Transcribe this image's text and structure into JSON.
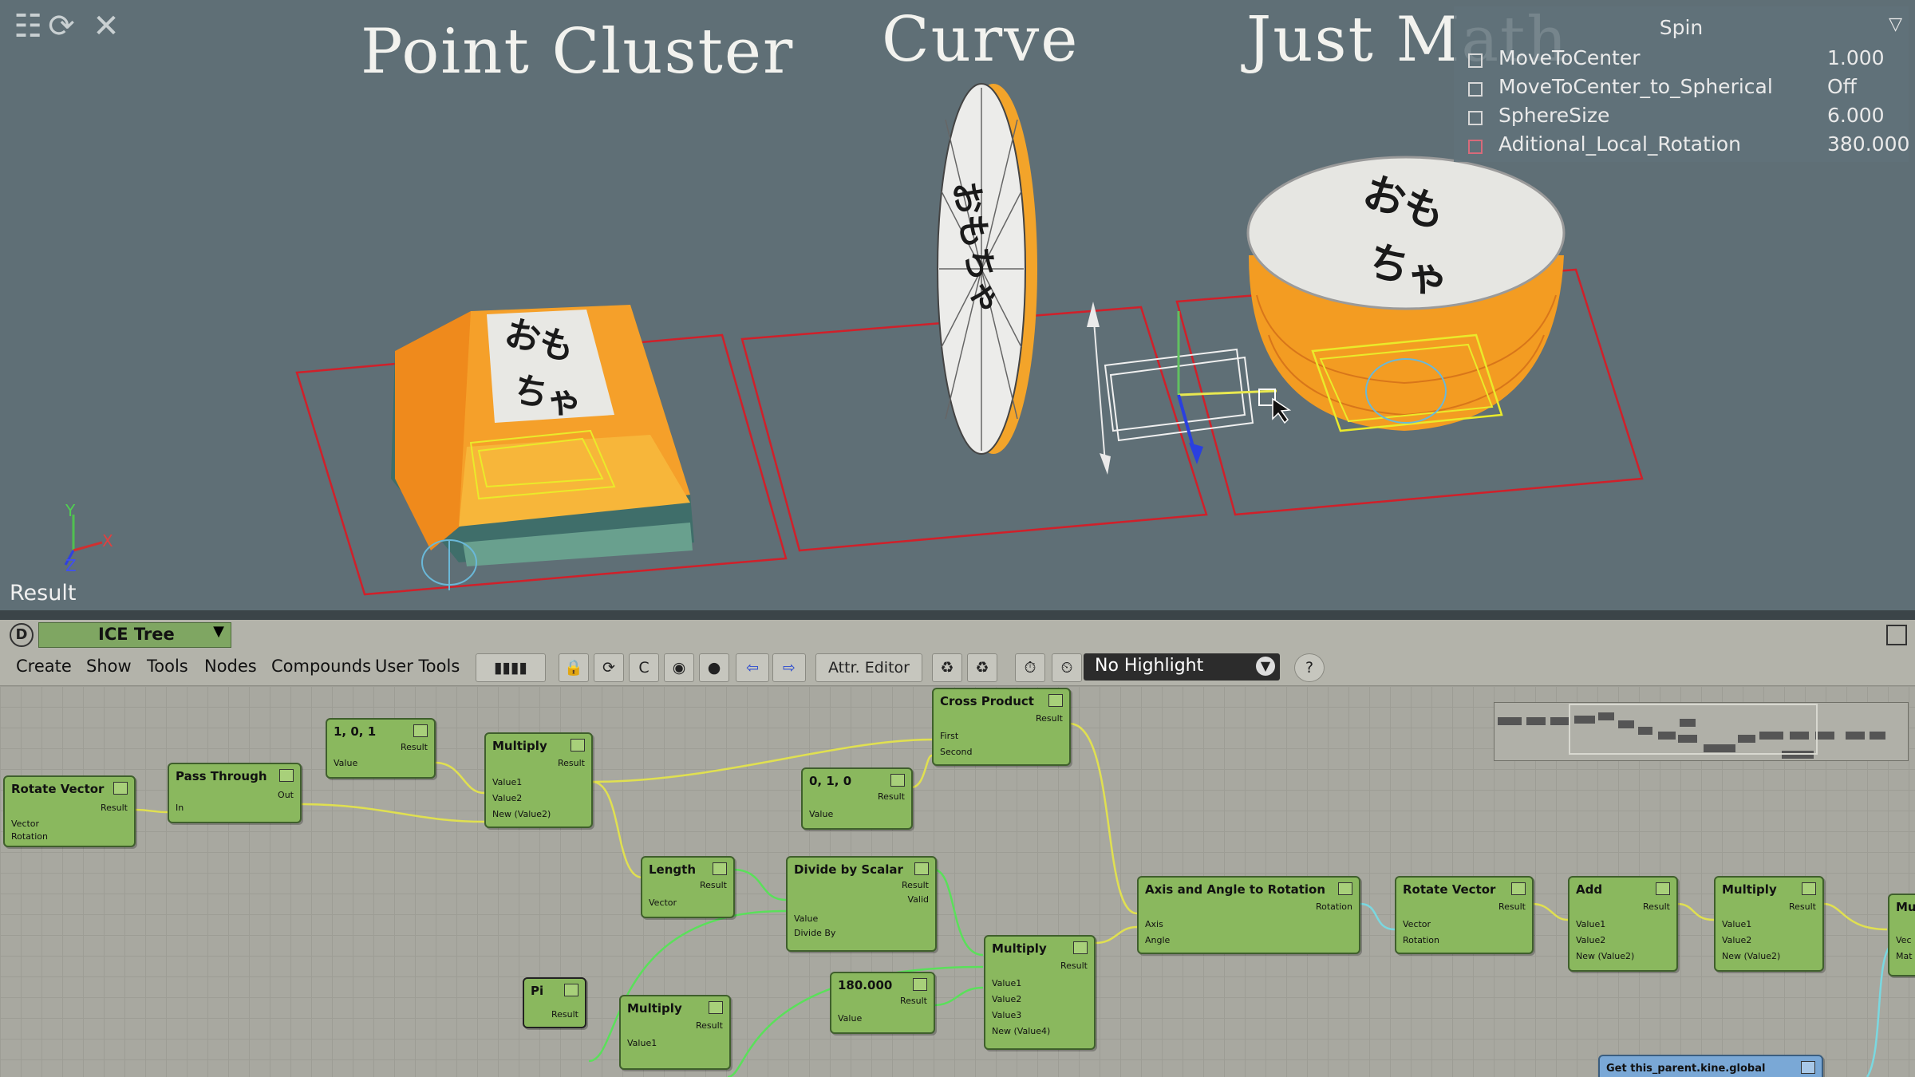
{
  "viewport": {
    "labels": [
      "Point Cluster",
      "Curve",
      "Just Math"
    ],
    "result_label": "Result",
    "axis_labels": {
      "x": "X",
      "y": "Y",
      "z": "Z"
    },
    "kana_text": "おもちゃ"
  },
  "property_panel": {
    "title": "Spin",
    "rows": [
      {
        "name": "MoveToCenter",
        "value": "1.000"
      },
      {
        "name": "MoveToCenter_to_Spherical",
        "value": "Off"
      },
      {
        "name": "SphereSize",
        "value": "6.000"
      },
      {
        "name": "Aditional_Local_Rotation",
        "value": "380.000"
      }
    ]
  },
  "ice_editor": {
    "badge": "D",
    "tree_title": "ICE Tree",
    "menus": [
      "Create",
      "Show",
      "Tools",
      "Nodes",
      "Compounds",
      "User Tools"
    ],
    "attr_editor": "Attr. Editor",
    "highlight": "No Highlight",
    "help": "?"
  },
  "nodes": {
    "rotate_vector_1": {
      "title": "Rotate Vector",
      "ports": [
        "Vector",
        "Rotation"
      ],
      "out": "Result"
    },
    "pass_through": {
      "title": "Pass Through",
      "ports": [
        "In"
      ],
      "out": "Out"
    },
    "vec_110": {
      "title": "1, 0, 1",
      "ports": [
        "Value"
      ],
      "out": "Result"
    },
    "multiply_1": {
      "title": "Multiply",
      "ports": [
        "Value1",
        "Value2",
        "New (Value2)"
      ],
      "out": "Result"
    },
    "cross_product": {
      "title": "Cross Product",
      "ports": [
        "First",
        "Second"
      ],
      "out": "Result"
    },
    "vec_010": {
      "title": "0, 1, 0",
      "ports": [
        "Value"
      ],
      "out": "Result"
    },
    "length": {
      "title": "Length",
      "ports": [
        "Vector"
      ],
      "out": "Result"
    },
    "divide_by_scalar": {
      "title": "Divide by Scalar",
      "ports": [
        "Value",
        "Divide By"
      ],
      "outs": [
        "Result",
        "Valid"
      ]
    },
    "pi": {
      "title": "Pi",
      "out": "Result"
    },
    "multiply_2": {
      "title": "Multiply",
      "ports": [
        "Value1"
      ],
      "out": "Result"
    },
    "scalar_180": {
      "title": "180.000",
      "ports": [
        "Value"
      ],
      "out": "Result"
    },
    "multiply_3": {
      "title": "Multiply",
      "ports": [
        "Value1",
        "Value2",
        "Value3",
        "New (Value4)"
      ],
      "out": "Result"
    },
    "axis_angle": {
      "title": "Axis and Angle to Rotation",
      "ports": [
        "Axis",
        "Angle"
      ],
      "out": "Rotation"
    },
    "rotate_vector_2": {
      "title": "Rotate Vector",
      "ports": [
        "Vector",
        "Rotation"
      ],
      "out": "Result"
    },
    "add": {
      "title": "Add",
      "ports": [
        "Value1",
        "Value2",
        "New (Value2)"
      ],
      "out": "Result"
    },
    "multiply_4": {
      "title": "Multiply",
      "ports": [
        "Value1",
        "Value2",
        "New (Value2)"
      ],
      "out": "Result"
    },
    "multiply_5": {
      "title": "Mu",
      "ports": [
        "Vec",
        "Mat"
      ]
    },
    "get_parent": {
      "title": "Get this_parent.kine.global"
    }
  },
  "colors": {
    "viewport_bg": "#5f6f76",
    "node_green": "#8ab85e",
    "wire_yellow": "#e0e050",
    "wire_green": "#5ae05a",
    "wire_cyan": "#7ad8e0",
    "selection_red": "#d0202a",
    "object_orange": "#f29a1e"
  }
}
